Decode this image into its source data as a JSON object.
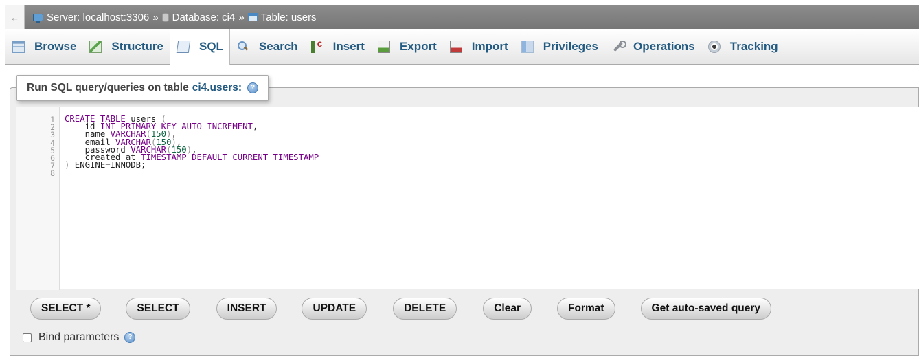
{
  "breadcrumb": {
    "back": "←",
    "server": "Server: localhost:3306",
    "sep1": "»",
    "database": "Database: ci4",
    "sep2": "»",
    "table": "Table: users"
  },
  "tabs": [
    {
      "label": "Browse",
      "icon": "browse-icon"
    },
    {
      "label": "Structure",
      "icon": "structure-icon"
    },
    {
      "label": "SQL",
      "icon": "sql-icon",
      "active": true
    },
    {
      "label": "Search",
      "icon": "search-icon"
    },
    {
      "label": "Insert",
      "icon": "insert-icon"
    },
    {
      "label": "Export",
      "icon": "export-icon"
    },
    {
      "label": "Import",
      "icon": "import-icon"
    },
    {
      "label": "Privileges",
      "icon": "privileges-icon"
    },
    {
      "label": "Operations",
      "icon": "operations-icon"
    },
    {
      "label": "Tracking",
      "icon": "tracking-icon"
    }
  ],
  "query_panel": {
    "legend_prefix": "Run SQL query/queries on table",
    "legend_table": "ci4.users:"
  },
  "editor": {
    "line_numbers": [
      "1",
      "2",
      "3",
      "4",
      "5",
      "6",
      "7",
      "8"
    ],
    "lines": [
      [
        {
          "t": "CREATE TABLE ",
          "c": "kw"
        },
        {
          "t": "users ",
          "c": ""
        },
        {
          "t": "(",
          "c": "br"
        }
      ],
      [
        {
          "t": "    id ",
          "c": ""
        },
        {
          "t": "INT PRIMARY KEY AUTO_INCREMENT",
          "c": "kw"
        },
        {
          "t": ",",
          "c": ""
        }
      ],
      [
        {
          "t": "    name ",
          "c": ""
        },
        {
          "t": "VARCHAR",
          "c": "kw"
        },
        {
          "t": "(",
          "c": "br"
        },
        {
          "t": "150",
          "c": "num"
        },
        {
          "t": ")",
          "c": "br"
        },
        {
          "t": ",",
          "c": ""
        }
      ],
      [
        {
          "t": "    email ",
          "c": ""
        },
        {
          "t": "VARCHAR",
          "c": "kw"
        },
        {
          "t": "(",
          "c": "br"
        },
        {
          "t": "150",
          "c": "num"
        },
        {
          "t": ")",
          "c": "br"
        },
        {
          "t": ",",
          "c": ""
        }
      ],
      [
        {
          "t": "    password ",
          "c": ""
        },
        {
          "t": "VARCHAR",
          "c": "kw"
        },
        {
          "t": "(",
          "c": "br"
        },
        {
          "t": "150",
          "c": "num"
        },
        {
          "t": ")",
          "c": "br"
        },
        {
          "t": ",",
          "c": ""
        }
      ],
      [
        {
          "t": "    created_at ",
          "c": ""
        },
        {
          "t": "TIMESTAMP DEFAULT CURRENT_TIMESTAMP",
          "c": "kw"
        }
      ],
      [
        {
          "t": ")",
          "c": "br"
        },
        {
          "t": " ENGINE=INNODB;",
          "c": ""
        }
      ],
      []
    ]
  },
  "buttons": [
    "SELECT *",
    "SELECT",
    "INSERT",
    "UPDATE",
    "DELETE",
    "Clear",
    "Format",
    "Get auto-saved query"
  ],
  "bind_parameters": {
    "label": "Bind parameters",
    "checked": false
  },
  "colors": {
    "link": "#235a81",
    "keyword": "#770088",
    "number": "#116644"
  }
}
